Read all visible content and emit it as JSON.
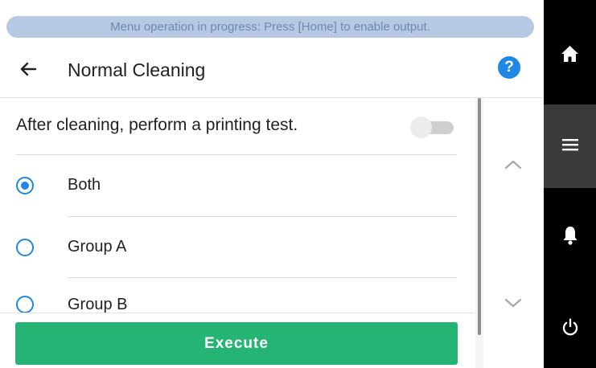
{
  "banner": {
    "text": "Menu operation in progress: Press [Home] to enable output."
  },
  "header": {
    "title": "Normal Cleaning",
    "help_label": "?"
  },
  "settings": {
    "print_test_label": "After cleaning, perform a printing test.",
    "print_test_enabled": false
  },
  "options": [
    {
      "label": "Both",
      "selected": true
    },
    {
      "label": "Group A",
      "selected": false
    },
    {
      "label": "Group B",
      "selected": false
    }
  ],
  "actions": {
    "execute_label": "Execute"
  },
  "nav": {
    "items": [
      {
        "icon": "home-icon",
        "active": false
      },
      {
        "icon": "menu-icon",
        "active": true
      },
      {
        "icon": "bell-icon",
        "active": false
      },
      {
        "icon": "power-icon",
        "active": false
      }
    ]
  },
  "colors": {
    "accent": "#1e88e5",
    "execute": "#25b473",
    "banner_bg": "#b7c9e2",
    "banner_text": "#6f88ad"
  }
}
